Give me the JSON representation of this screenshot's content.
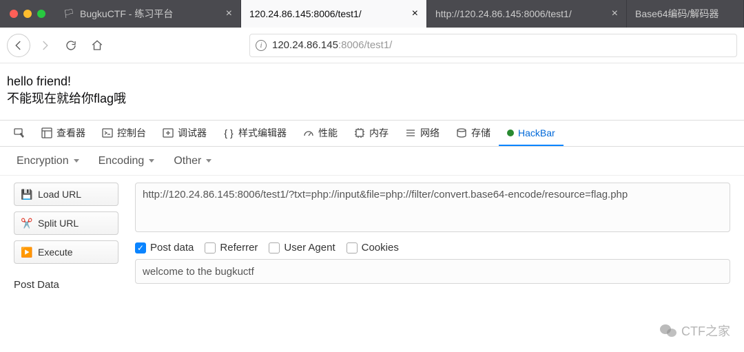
{
  "tabs": [
    {
      "label": "BugkuCTF - 练习平台",
      "active": false,
      "closeable": true
    },
    {
      "label": "120.24.86.145:8006/test1/",
      "active": true,
      "closeable": true
    },
    {
      "label": "http://120.24.86.145:8006/test1/",
      "active": false,
      "closeable": true
    },
    {
      "label": "Base64编码/解码器",
      "active": false,
      "closeable": false
    }
  ],
  "url": {
    "host": "120.24.86.145",
    "port": ":8006",
    "path": "/test1/"
  },
  "page": {
    "line1": "hello friend!",
    "line2": "不能现在就给你flag哦"
  },
  "devtools_tabs": [
    "查看器",
    "控制台",
    "调试器",
    "样式编辑器",
    "性能",
    "内存",
    "网络",
    "存储",
    "HackBar"
  ],
  "hackbar": {
    "encmenu": [
      "Encryption",
      "Encoding",
      "Other"
    ],
    "buttons": {
      "load": "Load URL",
      "split": "Split URL",
      "exec": "Execute"
    },
    "url": "http://120.24.86.145:8006/test1/?txt=php://input&file=php://filter/convert.base64-encode/resource=flag.php",
    "opts": {
      "post": "Post data",
      "ref": "Referrer",
      "ua": "User Agent",
      "ck": "Cookies"
    },
    "postlabel": "Post Data",
    "postval": "welcome to the bugkuctf"
  },
  "watermark": "CTF之家"
}
